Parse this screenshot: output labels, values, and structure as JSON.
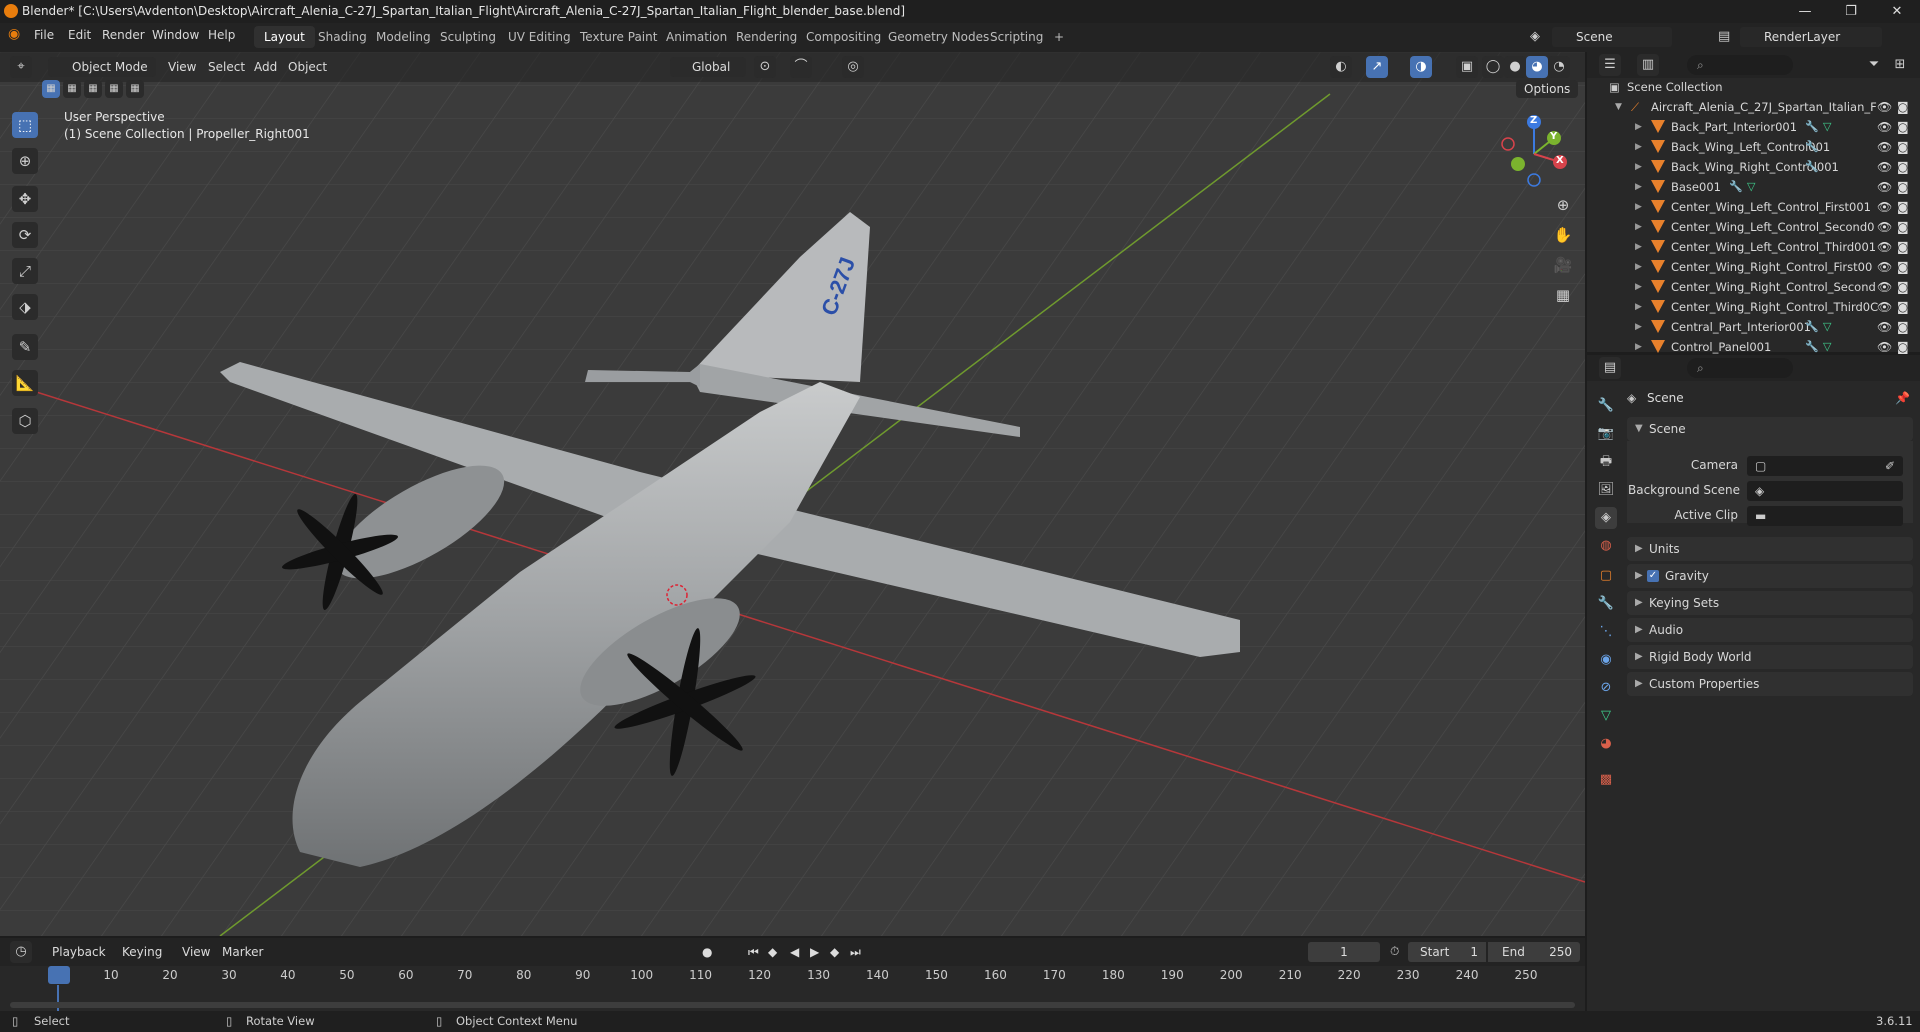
{
  "window": {
    "title": "Blender* [C:\\Users\\Avdenton\\Desktop\\Aircraft_Alenia_C-27J_Spartan_Italian_Flight\\Aircraft_Alenia_C-27J_Spartan_Italian_Flight_blender_base.blend]",
    "minimize": "—",
    "maximize": "❐",
    "close": "✕"
  },
  "menu": {
    "file": "File",
    "edit": "Edit",
    "render": "Render",
    "window": "Window",
    "help": "Help"
  },
  "workspaces": [
    "Layout",
    "Shading",
    "Modeling",
    "Sculpting",
    "UV Editing",
    "Texture Paint",
    "Animation",
    "Rendering",
    "Compositing",
    "Geometry Nodes",
    "Scripting"
  ],
  "workspace_add": "+",
  "scene_field": "Scene",
  "renderlayer_field": "RenderLayer",
  "viewport": {
    "mode": "Object Mode",
    "menus": [
      "View",
      "Select",
      "Add",
      "Object"
    ],
    "orientation": "Global",
    "options": "Options",
    "overlay_title": "User Perspective",
    "overlay_sub": "(1) Scene Collection | Propeller_Right001",
    "gizmo_axes": {
      "x": "X",
      "y": "Y",
      "z": "Z"
    },
    "aircraft_marking": "C-27J",
    "background_color": "#3b3b3b",
    "x_axis_color": "#c0393b",
    "y_axis_color": "#7aa632"
  },
  "outliner": {
    "search_placeholder": "",
    "root": "Scene Collection",
    "collection": "Aircraft_Alenia_C_27J_Spartan_Italian_F",
    "items": [
      {
        "name": "Back_Part_Interior001",
        "mod": true,
        "mesh": true
      },
      {
        "name": "Back_Wing_Left_Control001",
        "mod": true,
        "mesh": false
      },
      {
        "name": "Back_Wing_Right_Control001",
        "mod": true,
        "mesh": false
      },
      {
        "name": "Base001",
        "mod": true,
        "mesh": true
      },
      {
        "name": "Center_Wing_Left_Control_First001",
        "mod": false,
        "mesh": false
      },
      {
        "name": "Center_Wing_Left_Control_Second0",
        "mod": false,
        "mesh": false
      },
      {
        "name": "Center_Wing_Left_Control_Third001",
        "mod": false,
        "mesh": false
      },
      {
        "name": "Center_Wing_Right_Control_First00",
        "mod": false,
        "mesh": false
      },
      {
        "name": "Center_Wing_Right_Control_Second",
        "mod": false,
        "mesh": false
      },
      {
        "name": "Center_Wing_Right_Control_Third0C",
        "mod": false,
        "mesh": false
      },
      {
        "name": "Central_Part_Interior001",
        "mod": true,
        "mesh": true
      },
      {
        "name": "Control_Panel001",
        "mod": true,
        "mesh": true
      }
    ]
  },
  "properties": {
    "context": "Scene",
    "section": "Scene",
    "camera_label": "Camera",
    "bgscene_label": "Background Scene",
    "clip_label": "Active Clip",
    "panels": [
      "Units",
      "Gravity",
      "Keying Sets",
      "Audio",
      "Rigid Body World",
      "Custom Properties"
    ],
    "gravity_checked": true
  },
  "timeline": {
    "menus": [
      "Playback",
      "Keying",
      "View",
      "Marker"
    ],
    "current_frame": "1",
    "start_label": "Start",
    "start": "1",
    "end_label": "End",
    "end": "250",
    "ticks": [
      "1",
      "10",
      "20",
      "30",
      "40",
      "50",
      "60",
      "70",
      "80",
      "90",
      "100",
      "110",
      "120",
      "130",
      "140",
      "150",
      "160",
      "170",
      "180",
      "190",
      "200",
      "210",
      "220",
      "230",
      "240",
      "250"
    ]
  },
  "status": {
    "select": "Select",
    "rotate": "Rotate View",
    "context_menu": "Object Context Menu",
    "version": "3.6.11"
  }
}
